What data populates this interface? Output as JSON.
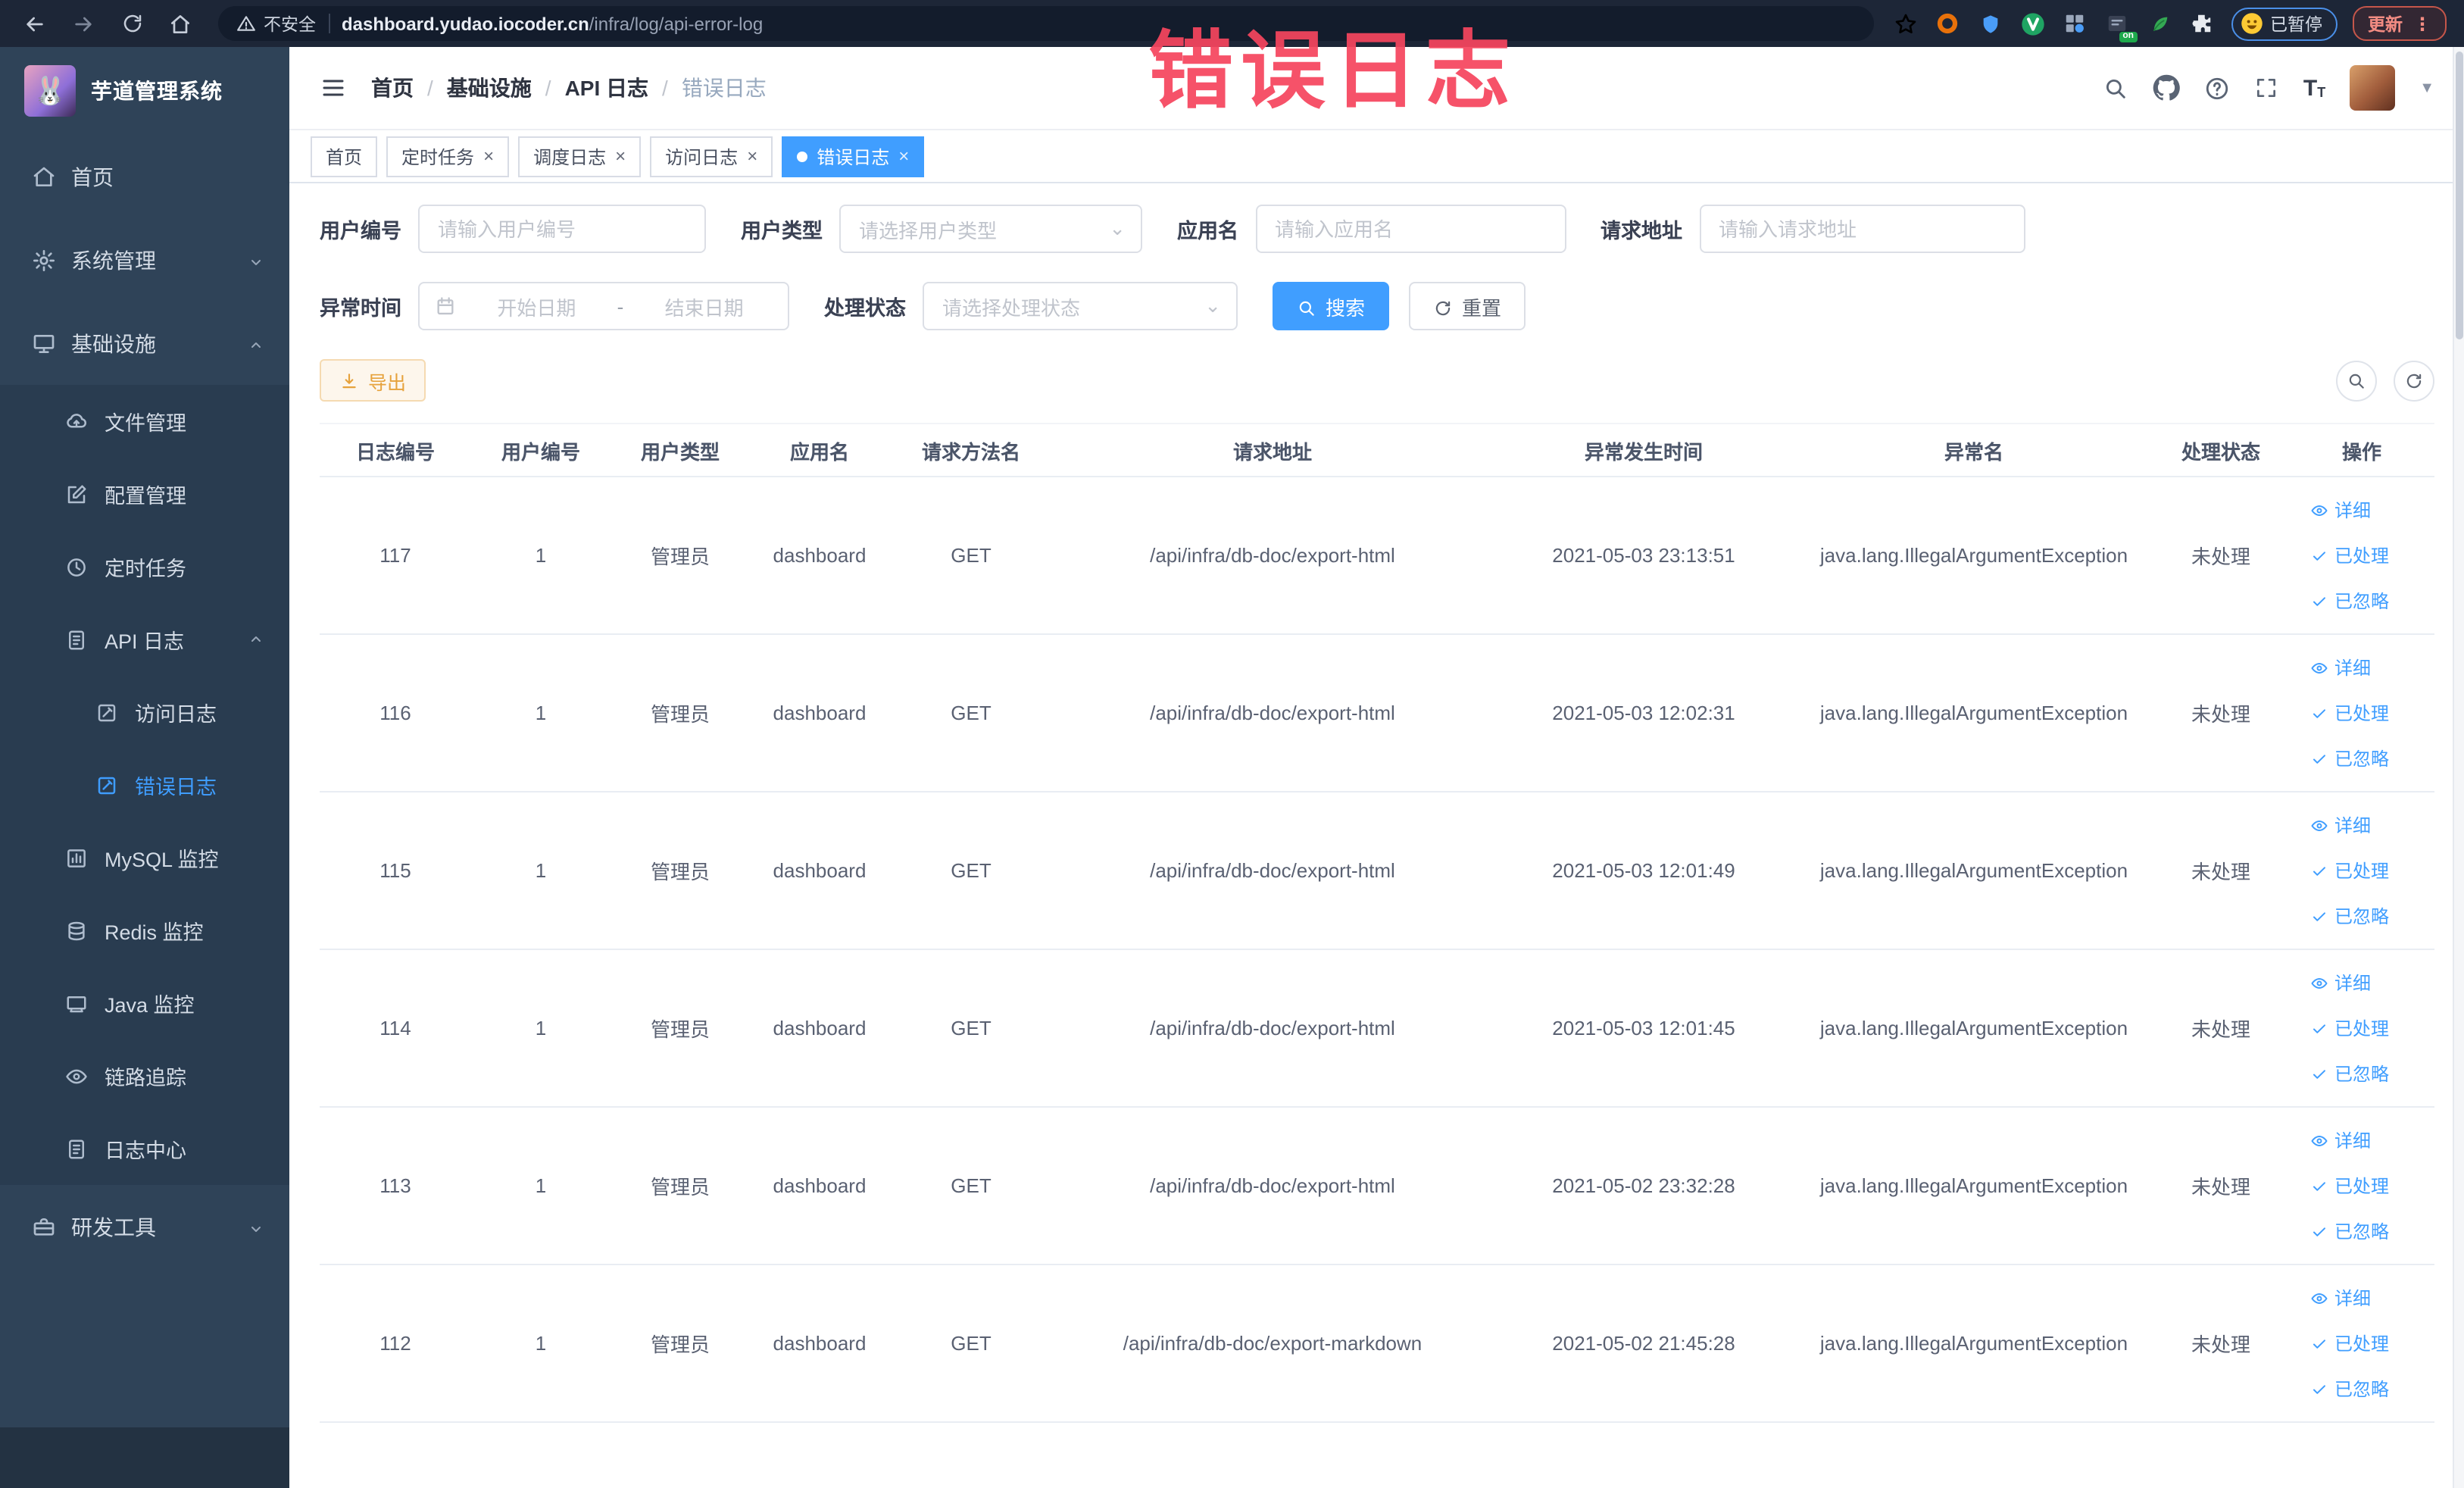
{
  "browser": {
    "security_label": "不安全",
    "url_domain": "dashboard.yudao.iocoder.cn",
    "url_path": "/infra/log/api-error-log",
    "paused_label": "已暂停",
    "update_label": "更新",
    "extensions": [
      {
        "name": "orange-ring-extension-icon"
      },
      {
        "name": "blue-shield-extension-icon"
      },
      {
        "name": "green-v-extension-icon"
      },
      {
        "name": "grid-extension-icon"
      },
      {
        "name": "switch-extension-icon",
        "badge": "on"
      },
      {
        "name": "leaf-extension-icon"
      },
      {
        "name": "puzzle-extensions-icon"
      }
    ]
  },
  "overlay": {
    "title": "错误日志"
  },
  "sidebar": {
    "title": "芋道管理系统",
    "items": [
      {
        "label": "首页",
        "icon": "home",
        "level": 1
      },
      {
        "label": "系统管理",
        "icon": "gear",
        "level": 1,
        "chevron": "down"
      },
      {
        "label": "基础设施",
        "icon": "monitor",
        "level": 1,
        "chevron": "up"
      },
      {
        "label": "文件管理",
        "icon": "cloud",
        "level": 2
      },
      {
        "label": "配置管理",
        "icon": "edit",
        "level": 2
      },
      {
        "label": "定时任务",
        "icon": "clock",
        "level": 2
      },
      {
        "label": "API 日志",
        "icon": "log",
        "level": 2,
        "chevron": "up"
      },
      {
        "label": "访问日志",
        "icon": "doc",
        "level": 3
      },
      {
        "label": "错误日志",
        "icon": "doc",
        "level": 3,
        "active": true
      },
      {
        "label": "MySQL 监控",
        "icon": "chart",
        "level": 2
      },
      {
        "label": "Redis 监控",
        "icon": "db",
        "level": 2
      },
      {
        "label": "Java 监控",
        "icon": "screen",
        "level": 2
      },
      {
        "label": "链路追踪",
        "icon": "eye",
        "level": 2
      },
      {
        "label": "日志中心",
        "icon": "log",
        "level": 2
      },
      {
        "label": "研发工具",
        "icon": "tool",
        "level": 1,
        "chevron": "down"
      }
    ]
  },
  "breadcrumb": [
    "首页",
    "基础设施",
    "API 日志",
    "错误日志"
  ],
  "tabs": [
    {
      "label": "首页",
      "closable": false,
      "active": false
    },
    {
      "label": "定时任务",
      "closable": true,
      "active": false
    },
    {
      "label": "调度日志",
      "closable": true,
      "active": false
    },
    {
      "label": "访问日志",
      "closable": true,
      "active": false
    },
    {
      "label": "错误日志",
      "closable": true,
      "active": true
    }
  ],
  "filters": {
    "user_id": {
      "label": "用户编号",
      "placeholder": "请输入用户编号"
    },
    "user_type": {
      "label": "用户类型",
      "placeholder": "请选择用户类型"
    },
    "app_name": {
      "label": "应用名",
      "placeholder": "请输入应用名"
    },
    "request_url": {
      "label": "请求地址",
      "placeholder": "请输入请求地址"
    },
    "error_time": {
      "label": "异常时间",
      "start_placeholder": "开始日期",
      "separator": "-",
      "end_placeholder": "结束日期"
    },
    "status": {
      "label": "处理状态",
      "placeholder": "请选择处理状态"
    },
    "search_label": "搜索",
    "reset_label": "重置"
  },
  "toolbar": {
    "export_label": "导出"
  },
  "table": {
    "columns": [
      "日志编号",
      "用户编号",
      "用户类型",
      "应用名",
      "请求方法名",
      "请求地址",
      "异常发生时间",
      "异常名",
      "处理状态",
      "操作"
    ],
    "actions": [
      "详细",
      "已处理",
      "已忽略"
    ],
    "rows": [
      {
        "id": "117",
        "user_id": "1",
        "user_type": "管理员",
        "app": "dashboard",
        "method": "GET",
        "url": "/api/infra/db-doc/export-html",
        "time": "2021-05-03 23:13:51",
        "exception": "java.lang.IllegalArgumentException",
        "status": "未处理"
      },
      {
        "id": "116",
        "user_id": "1",
        "user_type": "管理员",
        "app": "dashboard",
        "method": "GET",
        "url": "/api/infra/db-doc/export-html",
        "time": "2021-05-03 12:02:31",
        "exception": "java.lang.IllegalArgumentException",
        "status": "未处理"
      },
      {
        "id": "115",
        "user_id": "1",
        "user_type": "管理员",
        "app": "dashboard",
        "method": "GET",
        "url": "/api/infra/db-doc/export-html",
        "time": "2021-05-03 12:01:49",
        "exception": "java.lang.IllegalArgumentException",
        "status": "未处理"
      },
      {
        "id": "114",
        "user_id": "1",
        "user_type": "管理员",
        "app": "dashboard",
        "method": "GET",
        "url": "/api/infra/db-doc/export-html",
        "time": "2021-05-03 12:01:45",
        "exception": "java.lang.IllegalArgumentException",
        "status": "未处理"
      },
      {
        "id": "113",
        "user_id": "1",
        "user_type": "管理员",
        "app": "dashboard",
        "method": "GET",
        "url": "/api/infra/db-doc/export-html",
        "time": "2021-05-02 23:32:28",
        "exception": "java.lang.IllegalArgumentException",
        "status": "未处理"
      },
      {
        "id": "112",
        "user_id": "1",
        "user_type": "管理员",
        "app": "dashboard",
        "method": "GET",
        "url": "/api/infra/db-doc/export-markdown",
        "time": "2021-05-02 21:45:28",
        "exception": "java.lang.IllegalArgumentException",
        "status": "未处理"
      }
    ]
  },
  "colors": {
    "accent": "#409eff",
    "warning": "#e6a23c",
    "sidebar_bg": "#2f4358",
    "annotation_red": "#f5455e"
  }
}
